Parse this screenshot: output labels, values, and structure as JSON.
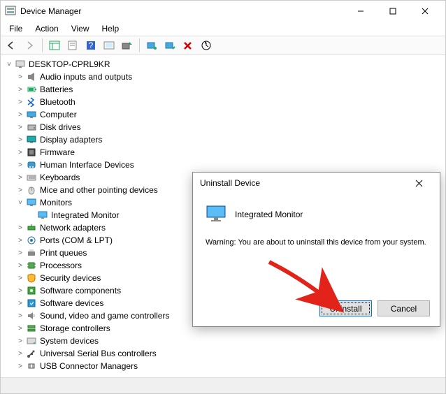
{
  "window": {
    "title": "Device Manager",
    "minimize": "–",
    "maximize": "□",
    "close": "✕"
  },
  "menubar": {
    "file": "File",
    "action": "Action",
    "view": "View",
    "help": "Help"
  },
  "tree": {
    "root": "DESKTOP-CPRL9KR",
    "items": [
      {
        "label": "Audio inputs and outputs",
        "icon": "speaker"
      },
      {
        "label": "Batteries",
        "icon": "battery"
      },
      {
        "label": "Bluetooth",
        "icon": "bluetooth"
      },
      {
        "label": "Computer",
        "icon": "computer"
      },
      {
        "label": "Disk drives",
        "icon": "disk"
      },
      {
        "label": "Display adapters",
        "icon": "display"
      },
      {
        "label": "Firmware",
        "icon": "firmware"
      },
      {
        "label": "Human Interface Devices",
        "icon": "hid"
      },
      {
        "label": "Keyboards",
        "icon": "keyboard"
      },
      {
        "label": "Mice and other pointing devices",
        "icon": "mouse"
      },
      {
        "label": "Monitors",
        "icon": "monitor",
        "expanded": true,
        "children": [
          {
            "label": "Integrated Monitor",
            "icon": "monitor"
          }
        ]
      },
      {
        "label": "Network adapters",
        "icon": "network"
      },
      {
        "label": "Ports (COM & LPT)",
        "icon": "port"
      },
      {
        "label": "Print queues",
        "icon": "printer"
      },
      {
        "label": "Processors",
        "icon": "cpu"
      },
      {
        "label": "Security devices",
        "icon": "security"
      },
      {
        "label": "Software components",
        "icon": "swcomp"
      },
      {
        "label": "Software devices",
        "icon": "swdev"
      },
      {
        "label": "Sound, video and game controllers",
        "icon": "sound"
      },
      {
        "label": "Storage controllers",
        "icon": "storage"
      },
      {
        "label": "System devices",
        "icon": "system"
      },
      {
        "label": "Universal Serial Bus controllers",
        "icon": "usb"
      },
      {
        "label": "USB Connector Managers",
        "icon": "usbconn"
      }
    ]
  },
  "dialog": {
    "title": "Uninstall Device",
    "device": "Integrated Monitor",
    "warning": "Warning: You are about to uninstall this device from your system.",
    "uninstall": "Uninstall",
    "cancel": "Cancel",
    "close": "✕"
  }
}
